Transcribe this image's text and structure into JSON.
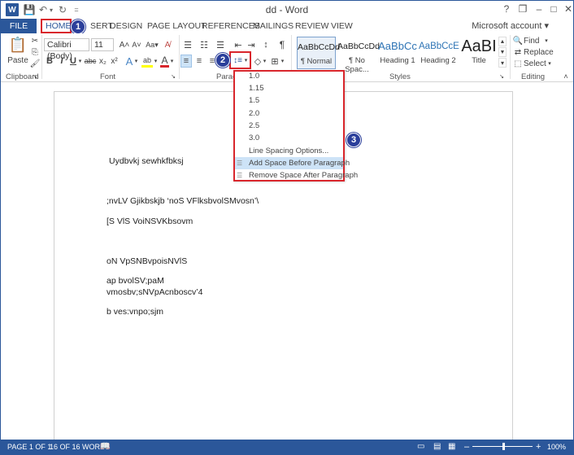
{
  "window": {
    "title": "dd - Word",
    "logo": "W",
    "help": "?",
    "restore": "❐",
    "minimize": "–",
    "maximize": "□",
    "close": "✕"
  },
  "quick_access": {
    "save": "💾",
    "undo": "↶",
    "undo_arrow": "▾",
    "redo": "↻",
    "customize": "="
  },
  "tabs": [
    "FILE",
    "HOME",
    "INSERT",
    "DESIGN",
    "PAGE LAYOUT",
    "REFERENCES",
    "MAILINGS",
    "REVIEW",
    "VIEW"
  ],
  "tab_partial_insert": "SERT",
  "account": "Microsoft account ▾",
  "ribbon": {
    "clipboard": {
      "paste": "Paste",
      "label": "Clipboard",
      "launcher": "↘"
    },
    "font": {
      "family": "Calibri (Body)",
      "size": "11",
      "grow": "A˄",
      "shrink": "A˅",
      "case": "Aa▾",
      "clear": "A̸",
      "bold": "B",
      "italic": "I",
      "underline": "U",
      "underline_arrow": "▾",
      "strike": "abc",
      "subscript": "x₂",
      "superscript": "x²",
      "effects": "A",
      "effects_arrow": "▾",
      "highlight": "ab",
      "highlight_arrow": "▾",
      "color": "A",
      "color_arrow": "▾",
      "label": "Font",
      "launcher": "↘"
    },
    "paragraph": {
      "bullets": "☰",
      "numbering": "☷",
      "multilevel": "☰",
      "decrease_indent": "⇤",
      "increase_indent": "⇥",
      "sort": "↕",
      "pilcrow": "¶",
      "align_left": "≡",
      "center": "≡",
      "align_right": "≡",
      "line_spacing": "↕≡",
      "line_spacing_arrow": "▾",
      "shading": "◇",
      "shading_arrow": "▾",
      "borders": "⊞",
      "borders_arrow": "▾",
      "label": "Paragraph",
      "label_visible": "Parag",
      "launcher": "↘"
    },
    "styles": {
      "items": [
        {
          "sample": "AaBbCcDd",
          "name": "¶ Normal"
        },
        {
          "sample": "AaBbCcDd",
          "name": "¶ No Spac..."
        },
        {
          "sample": "AaBbCc",
          "name": "Heading 1"
        },
        {
          "sample": "AaBbCcE",
          "name": "Heading 2"
        },
        {
          "sample": "AaBI",
          "name": "Title"
        }
      ],
      "label": "Styles",
      "launcher": "↘",
      "scroll_up": "▲",
      "scroll_down": "▼",
      "more": "▾"
    },
    "editing": {
      "find": "Find",
      "find_arrow": "▾",
      "replace": "Replace",
      "select": "Select",
      "select_arrow": "▾",
      "label": "Editing",
      "collapse": "˄"
    }
  },
  "annotations": [
    "1",
    "2",
    "3"
  ],
  "line_spacing_menu": {
    "options": [
      "1.0",
      "1.15",
      "1.5",
      "2.0",
      "2.5",
      "3.0"
    ],
    "more": "Line Spacing Options...",
    "add_space": "Add Space Before Paragraph",
    "remove_space": "Remove Space After Paragraph"
  },
  "document": {
    "lines": [
      "Uydbvkj sewhkfbksj",
      ";nvLV Gjikbskjb ‘noS VFlksbvolSMvosn’\\",
      "[S VlS VoiNSVKbsovm",
      "oN VpSNBvpoisNVlS",
      "ap bvolSV;paM",
      "vmosbv;sNVpAcnboscv’4",
      "b ves:vnpo;sjm"
    ]
  },
  "status": {
    "page": "PAGE 1 OF 1",
    "words": "16 OF 16 WORDS",
    "proofing": "📖",
    "zoom": "100%",
    "zoom_out": "–",
    "zoom_in": "+",
    "colors": {
      "bar": "#2b579a",
      "annotation": "#d9262c"
    }
  }
}
